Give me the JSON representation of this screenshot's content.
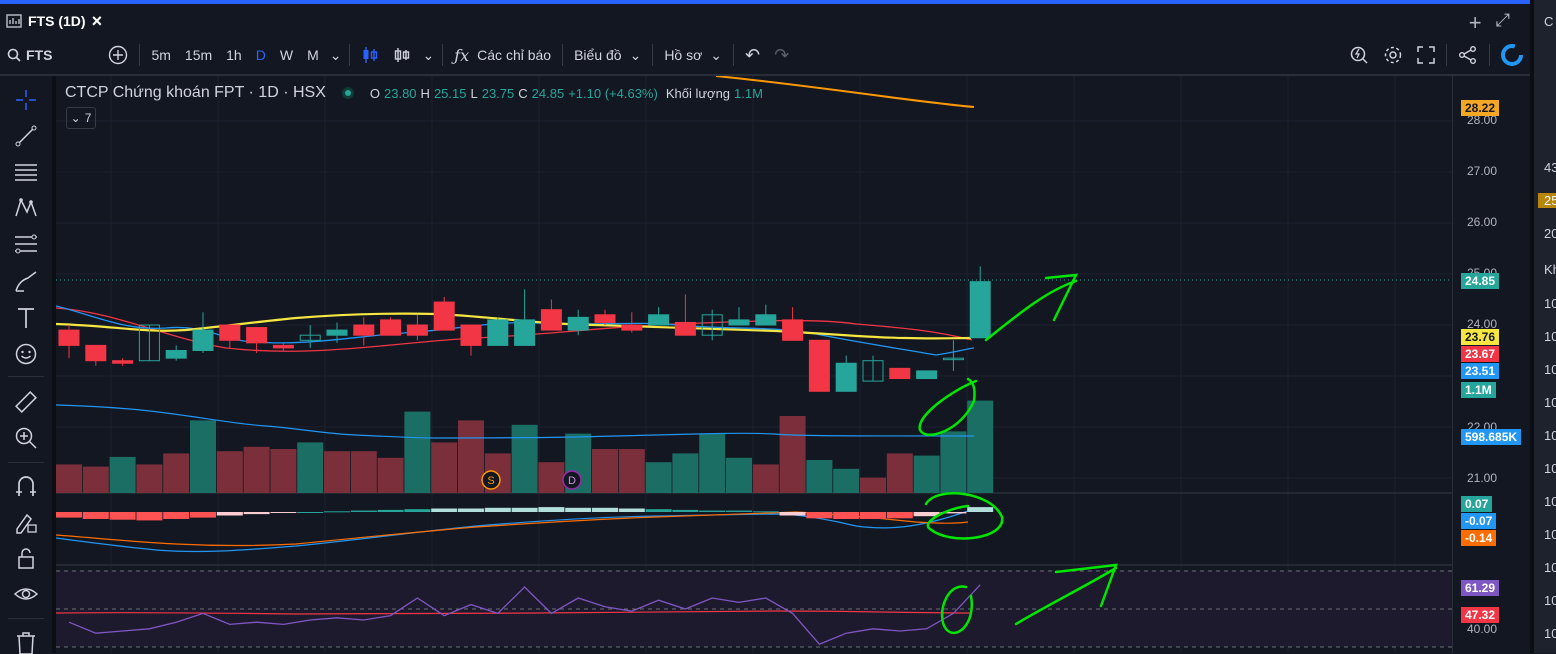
{
  "window": {
    "tab_title": "FTS (1D)",
    "close_label": "×",
    "add_label": "+",
    "expand_label": "⤢"
  },
  "toolbar": {
    "symbol": "FTS",
    "intervals": [
      "5m",
      "15m",
      "1h",
      "D",
      "W",
      "M"
    ],
    "active_interval": "D",
    "indicators_label": "Các chỉ báo",
    "chart_type_label": "Biểu đồ",
    "profile_label": "Hồ sơ"
  },
  "legend": {
    "title": "CTCP Chứng khoán FPT · 1D · HSX",
    "o_key": "O",
    "o_val": "23.80",
    "h_key": "H",
    "h_val": "25.15",
    "l_key": "L",
    "l_val": "23.75",
    "c_key": "C",
    "c_val": "24.85",
    "change": "+1.10 (+4.63%)",
    "volume_key": "Khối lượng",
    "volume_val": "1.1M",
    "collapse_count": "7"
  },
  "price_axis": {
    "ticks": [
      "28.00",
      "27.00",
      "26.00",
      "25.00",
      "24.00",
      "22.00",
      "21.00",
      "40.00"
    ],
    "tags": [
      {
        "text": "28.22",
        "color": "#f5a623",
        "text_color": "#131722"
      },
      {
        "text": "24.85",
        "color": "#26a69a",
        "text_color": "#ffffff"
      },
      {
        "text": "23.76",
        "color": "#f5e642",
        "text_color": "#131722"
      },
      {
        "text": "23.67",
        "color": "#f23645",
        "text_color": "#ffffff"
      },
      {
        "text": "23.51",
        "color": "#2196f3",
        "text_color": "#ffffff"
      },
      {
        "text": "1.1M",
        "color": "#26a69a",
        "text_color": "#ffffff"
      },
      {
        "text": "598.685K",
        "color": "#2196f3",
        "text_color": "#ffffff"
      },
      {
        "text": "0.07",
        "color": "#26a69a",
        "text_color": "#ffffff"
      },
      {
        "text": "-0.07",
        "color": "#2196f3",
        "text_color": "#ffffff"
      },
      {
        "text": "-0.14",
        "color": "#ff6d00",
        "text_color": "#ffffff"
      },
      {
        "text": "61.29",
        "color": "#7e57c2",
        "text_color": "#ffffff"
      },
      {
        "text": "47.32",
        "color": "#f23645",
        "text_color": "#ffffff"
      }
    ]
  },
  "markers": {
    "s": "S",
    "d": "D"
  },
  "right_panel": {
    "items": [
      "C",
      "43",
      "25",
      "20",
      "Kh",
      "10",
      "10",
      "10",
      "10",
      "10",
      "10",
      "10",
      "10",
      "10",
      "10",
      "10"
    ]
  },
  "colors": {
    "up": "#26a69a",
    "down": "#f23645",
    "accent": "#2962ff",
    "annotation": "#00e600"
  },
  "chart_data": {
    "type": "candlestick",
    "ylim": [
      20.6,
      28.4
    ],
    "candles": [
      [
        23.9,
        23.6,
        24.0,
        23.35
      ],
      [
        23.6,
        23.3,
        23.6,
        23.2
      ],
      [
        23.3,
        23.25,
        23.35,
        23.2
      ],
      [
        23.3,
        24.0,
        24.0,
        23.3
      ],
      [
        23.35,
        23.5,
        23.6,
        23.3
      ],
      [
        23.5,
        23.9,
        24.25,
        23.45
      ],
      [
        24.0,
        23.7,
        24.0,
        23.55
      ],
      [
        23.95,
        23.65,
        23.95,
        23.45
      ],
      [
        23.6,
        23.55,
        23.65,
        23.5
      ],
      [
        23.7,
        23.8,
        24.0,
        23.55
      ],
      [
        23.8,
        23.9,
        24.05,
        23.65
      ],
      [
        24.0,
        23.8,
        24.15,
        23.6
      ],
      [
        24.1,
        23.8,
        24.15,
        23.8
      ],
      [
        24.0,
        23.8,
        24.2,
        23.7
      ],
      [
        24.45,
        23.9,
        24.55,
        23.9
      ],
      [
        24.0,
        23.6,
        24.0,
        23.4
      ],
      [
        23.6,
        24.1,
        24.15,
        23.6
      ],
      [
        23.6,
        24.1,
        24.7,
        23.6
      ],
      [
        24.3,
        23.9,
        24.5,
        23.9
      ],
      [
        23.9,
        24.15,
        24.3,
        23.8
      ],
      [
        24.2,
        24.05,
        24.3,
        24.0
      ],
      [
        24.0,
        23.9,
        24.25,
        23.85
      ],
      [
        24.0,
        24.2,
        24.35,
        24.0
      ],
      [
        24.05,
        23.8,
        24.6,
        23.8
      ],
      [
        23.8,
        24.2,
        24.3,
        23.7
      ],
      [
        24.0,
        24.1,
        24.35,
        24.0
      ],
      [
        24.0,
        24.2,
        24.4,
        24.0
      ],
      [
        24.1,
        23.7,
        24.35,
        23.7
      ],
      [
        23.7,
        22.7,
        23.7,
        22.7
      ],
      [
        22.7,
        23.25,
        23.4,
        22.7
      ],
      [
        22.9,
        23.3,
        23.4,
        22.9
      ],
      [
        23.15,
        22.95,
        23.15,
        22.95
      ],
      [
        22.95,
        23.1,
        23.1,
        22.95
      ],
      [
        23.35,
        23.35,
        23.7,
        23.1
      ],
      [
        23.75,
        24.85,
        25.15,
        23.75
      ]
    ],
    "volume": [
      {
        "v": 0.65,
        "up": false
      },
      {
        "v": 0.6,
        "up": false
      },
      {
        "v": 0.82,
        "up": true
      },
      {
        "v": 0.65,
        "up": false
      },
      {
        "v": 0.9,
        "up": false
      },
      {
        "v": 1.65,
        "up": true
      },
      {
        "v": 0.95,
        "up": false
      },
      {
        "v": 1.05,
        "up": false
      },
      {
        "v": 1.0,
        "up": false
      },
      {
        "v": 1.15,
        "up": true
      },
      {
        "v": 0.95,
        "up": false
      },
      {
        "v": 0.95,
        "up": false
      },
      {
        "v": 0.8,
        "up": false
      },
      {
        "v": 1.85,
        "up": true
      },
      {
        "v": 1.15,
        "up": false
      },
      {
        "v": 1.65,
        "up": false
      },
      {
        "v": 0.9,
        "up": false
      },
      {
        "v": 1.55,
        "up": true
      },
      {
        "v": 0.7,
        "up": false
      },
      {
        "v": 1.35,
        "up": true
      },
      {
        "v": 1.0,
        "up": false
      },
      {
        "v": 1.0,
        "up": false
      },
      {
        "v": 0.7,
        "up": true
      },
      {
        "v": 0.9,
        "up": true
      },
      {
        "v": 1.35,
        "up": true
      },
      {
        "v": 0.8,
        "up": true
      },
      {
        "v": 0.65,
        "up": false
      },
      {
        "v": 1.75,
        "up": false
      },
      {
        "v": 0.75,
        "up": true
      },
      {
        "v": 0.55,
        "up": true
      },
      {
        "v": 0.35,
        "up": false
      },
      {
        "v": 0.9,
        "up": false
      },
      {
        "v": 0.85,
        "up": true
      },
      {
        "v": 1.4,
        "up": true
      },
      {
        "v": 2.1,
        "up": true
      }
    ],
    "macd_hist": [
      -0.08,
      -0.1,
      -0.11,
      -0.12,
      -0.1,
      -0.08,
      -0.05,
      -0.03,
      -0.01,
      0.0,
      0.01,
      0.02,
      0.03,
      0.04,
      0.05,
      0.05,
      0.06,
      0.06,
      0.07,
      0.06,
      0.06,
      0.05,
      0.04,
      0.03,
      0.02,
      0.02,
      0.01,
      -0.05,
      -0.09,
      -0.1,
      -0.1,
      -0.09,
      -0.06,
      -0.02,
      0.07
    ],
    "rsi": [
      44,
      39,
      40,
      41,
      44,
      48,
      43,
      44,
      43,
      45,
      46,
      45,
      47,
      55,
      47,
      52,
      48,
      60,
      48,
      55,
      51,
      49,
      54,
      50,
      55,
      53,
      55,
      48,
      34,
      39,
      41,
      40,
      41,
      48,
      61
    ]
  }
}
